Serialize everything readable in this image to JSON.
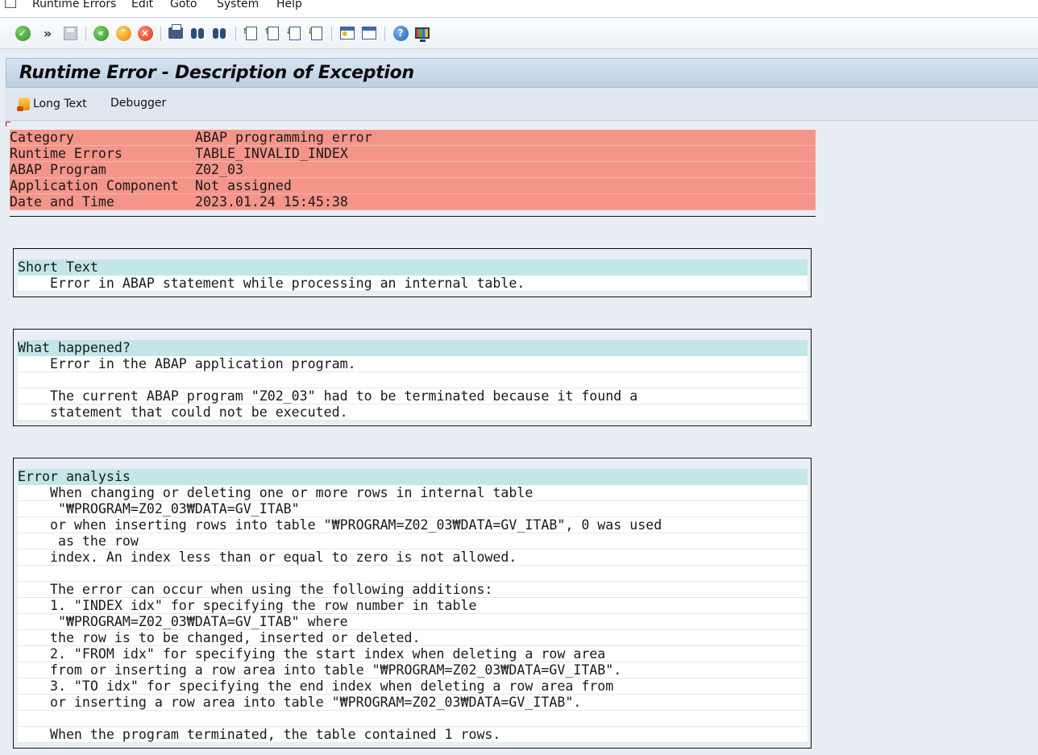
{
  "menu": {
    "items": [
      {
        "label": "Runtime Errors"
      },
      {
        "label": "Edit"
      },
      {
        "label": "Goto"
      },
      {
        "label": "System"
      },
      {
        "label": "Help"
      }
    ]
  },
  "page": {
    "title": "Runtime Error - Description of Exception"
  },
  "app_toolbar": {
    "long_text": "Long Text",
    "debugger": "Debugger"
  },
  "header_fields": [
    {
      "key": "Category",
      "value": "ABAP programming error"
    },
    {
      "key": "Runtime Errors",
      "value": "TABLE_INVALID_INDEX"
    },
    {
      "key": "ABAP Program",
      "value": "Z02_03"
    },
    {
      "key": "Application Component",
      "value": "Not assigned"
    },
    {
      "key": "Date and Time",
      "value": "2023.01.24 15:45:38"
    }
  ],
  "sections": {
    "short_text": {
      "heading": "Short Text",
      "lines": [
        "    Error in ABAP statement while processing an internal table."
      ]
    },
    "what_happened": {
      "heading": "What happened?",
      "lines": [
        "    Error in the ABAP application program.",
        "",
        "    The current ABAP program \"Z02_03\" had to be terminated because it found a",
        "    statement that could not be executed."
      ]
    },
    "error_analysis": {
      "heading": "Error analysis",
      "lines": [
        "    When changing or deleting one or more rows in internal table",
        "     \"₩PROGRAM=Z02_03₩DATA=GV_ITAB\"",
        "    or when inserting rows into table \"₩PROGRAM=Z02_03₩DATA=GV_ITAB\", 0 was used",
        "     as the row",
        "    index. An index less than or equal to zero is not allowed.",
        "",
        "    The error can occur when using the following additions:",
        "    1. \"INDEX idx\" for specifying the row number in table",
        "     \"₩PROGRAM=Z02_03₩DATA=GV_ITAB\" where",
        "    the row is to be changed, inserted or deleted.",
        "    2. \"FROM idx\" for specifying the start index when deleting a row area",
        "    from or inserting a row area into table \"₩PROGRAM=Z02_03₩DATA=GV_ITAB\".",
        "    3. \"TO idx\" for specifying the end index when deleting a row area from",
        "    or inserting a row area into table \"₩PROGRAM=Z02_03₩DATA=GV_ITAB\".",
        "",
        "    When the program terminated, the table contained 1 rows."
      ]
    }
  }
}
